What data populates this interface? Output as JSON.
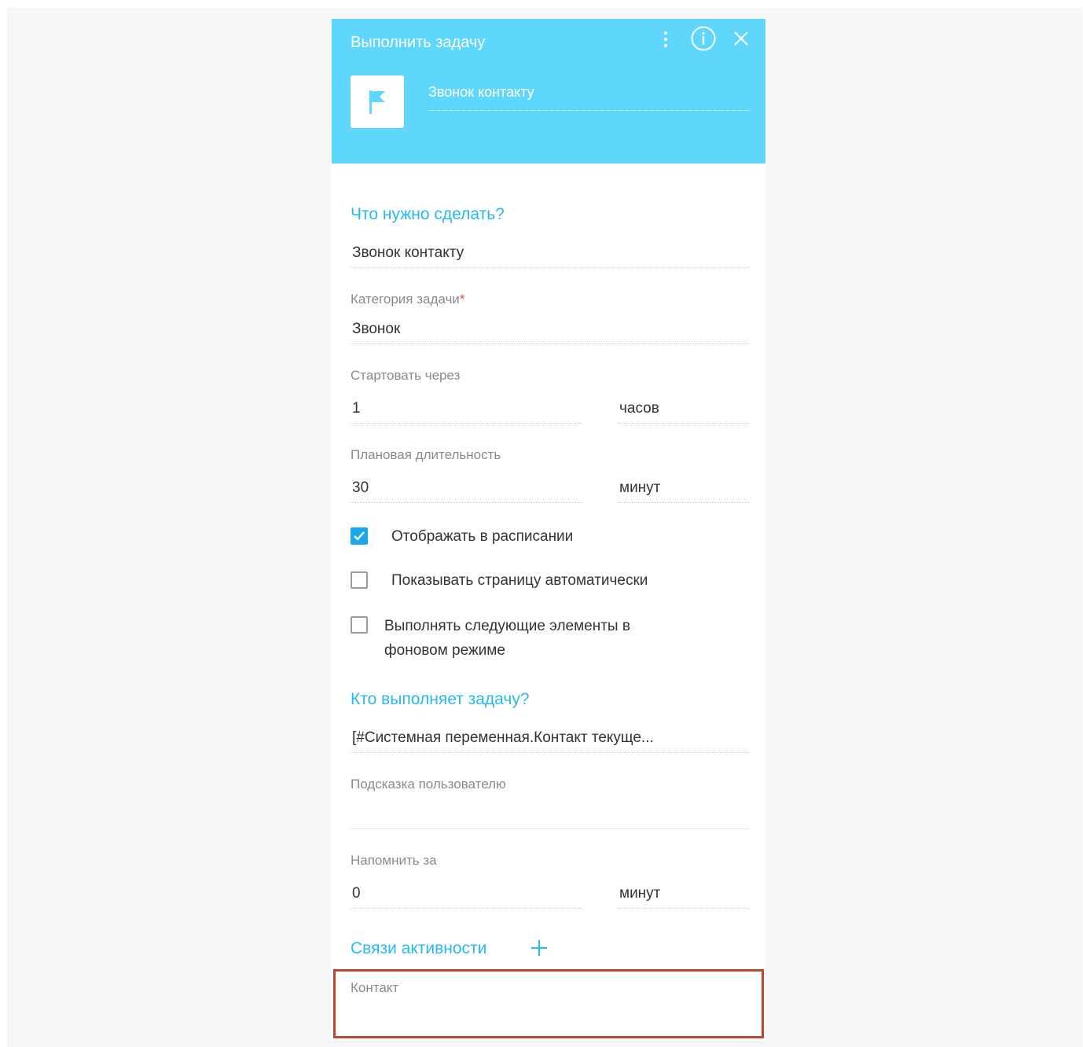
{
  "window": {
    "title": "Выполнить задачу",
    "task_name": "Звонок контакту"
  },
  "colors": {
    "header_bg": "#5fd7fd",
    "accent": "#27b9f3",
    "checkbox_checked": "#1aa7ee",
    "required": "#f24545",
    "highlight_border": "#c0462e"
  },
  "icons": {
    "menu": "kebab-menu-icon",
    "info": "info-icon",
    "close": "close-icon",
    "task": "flag-icon",
    "add": "plus-icon"
  },
  "what": {
    "section": "Что нужно сделать?",
    "subject": "Звонок контакту",
    "category_label": "Категория задачи",
    "category_required": "*",
    "category_value": "Звонок",
    "start_label": "Стартовать через",
    "start_value": "1",
    "start_unit": "часов",
    "duration_label": "Плановая длительность",
    "duration_value": "30",
    "duration_unit": "минут"
  },
  "options": {
    "show_in_schedule": {
      "label": "Отображать в расписании",
      "checked": true
    },
    "show_page_auto": {
      "label": "Показывать страницу автоматически",
      "checked": false
    },
    "background_mode": {
      "label_line1": "Выполнять следующие элементы в",
      "label_line2": "фоновом режиме",
      "checked": false
    }
  },
  "who": {
    "section": "Кто выполняет задачу?",
    "owner": "[#Системная переменная.Контакт текуще...",
    "hint_label": "Подсказка пользователю",
    "hint_value": "",
    "remind_label": "Напомнить за",
    "remind_value": "0",
    "remind_unit": "минут"
  },
  "links": {
    "section": "Связи активности",
    "contact_label": "Контакт",
    "contact_value": ""
  }
}
